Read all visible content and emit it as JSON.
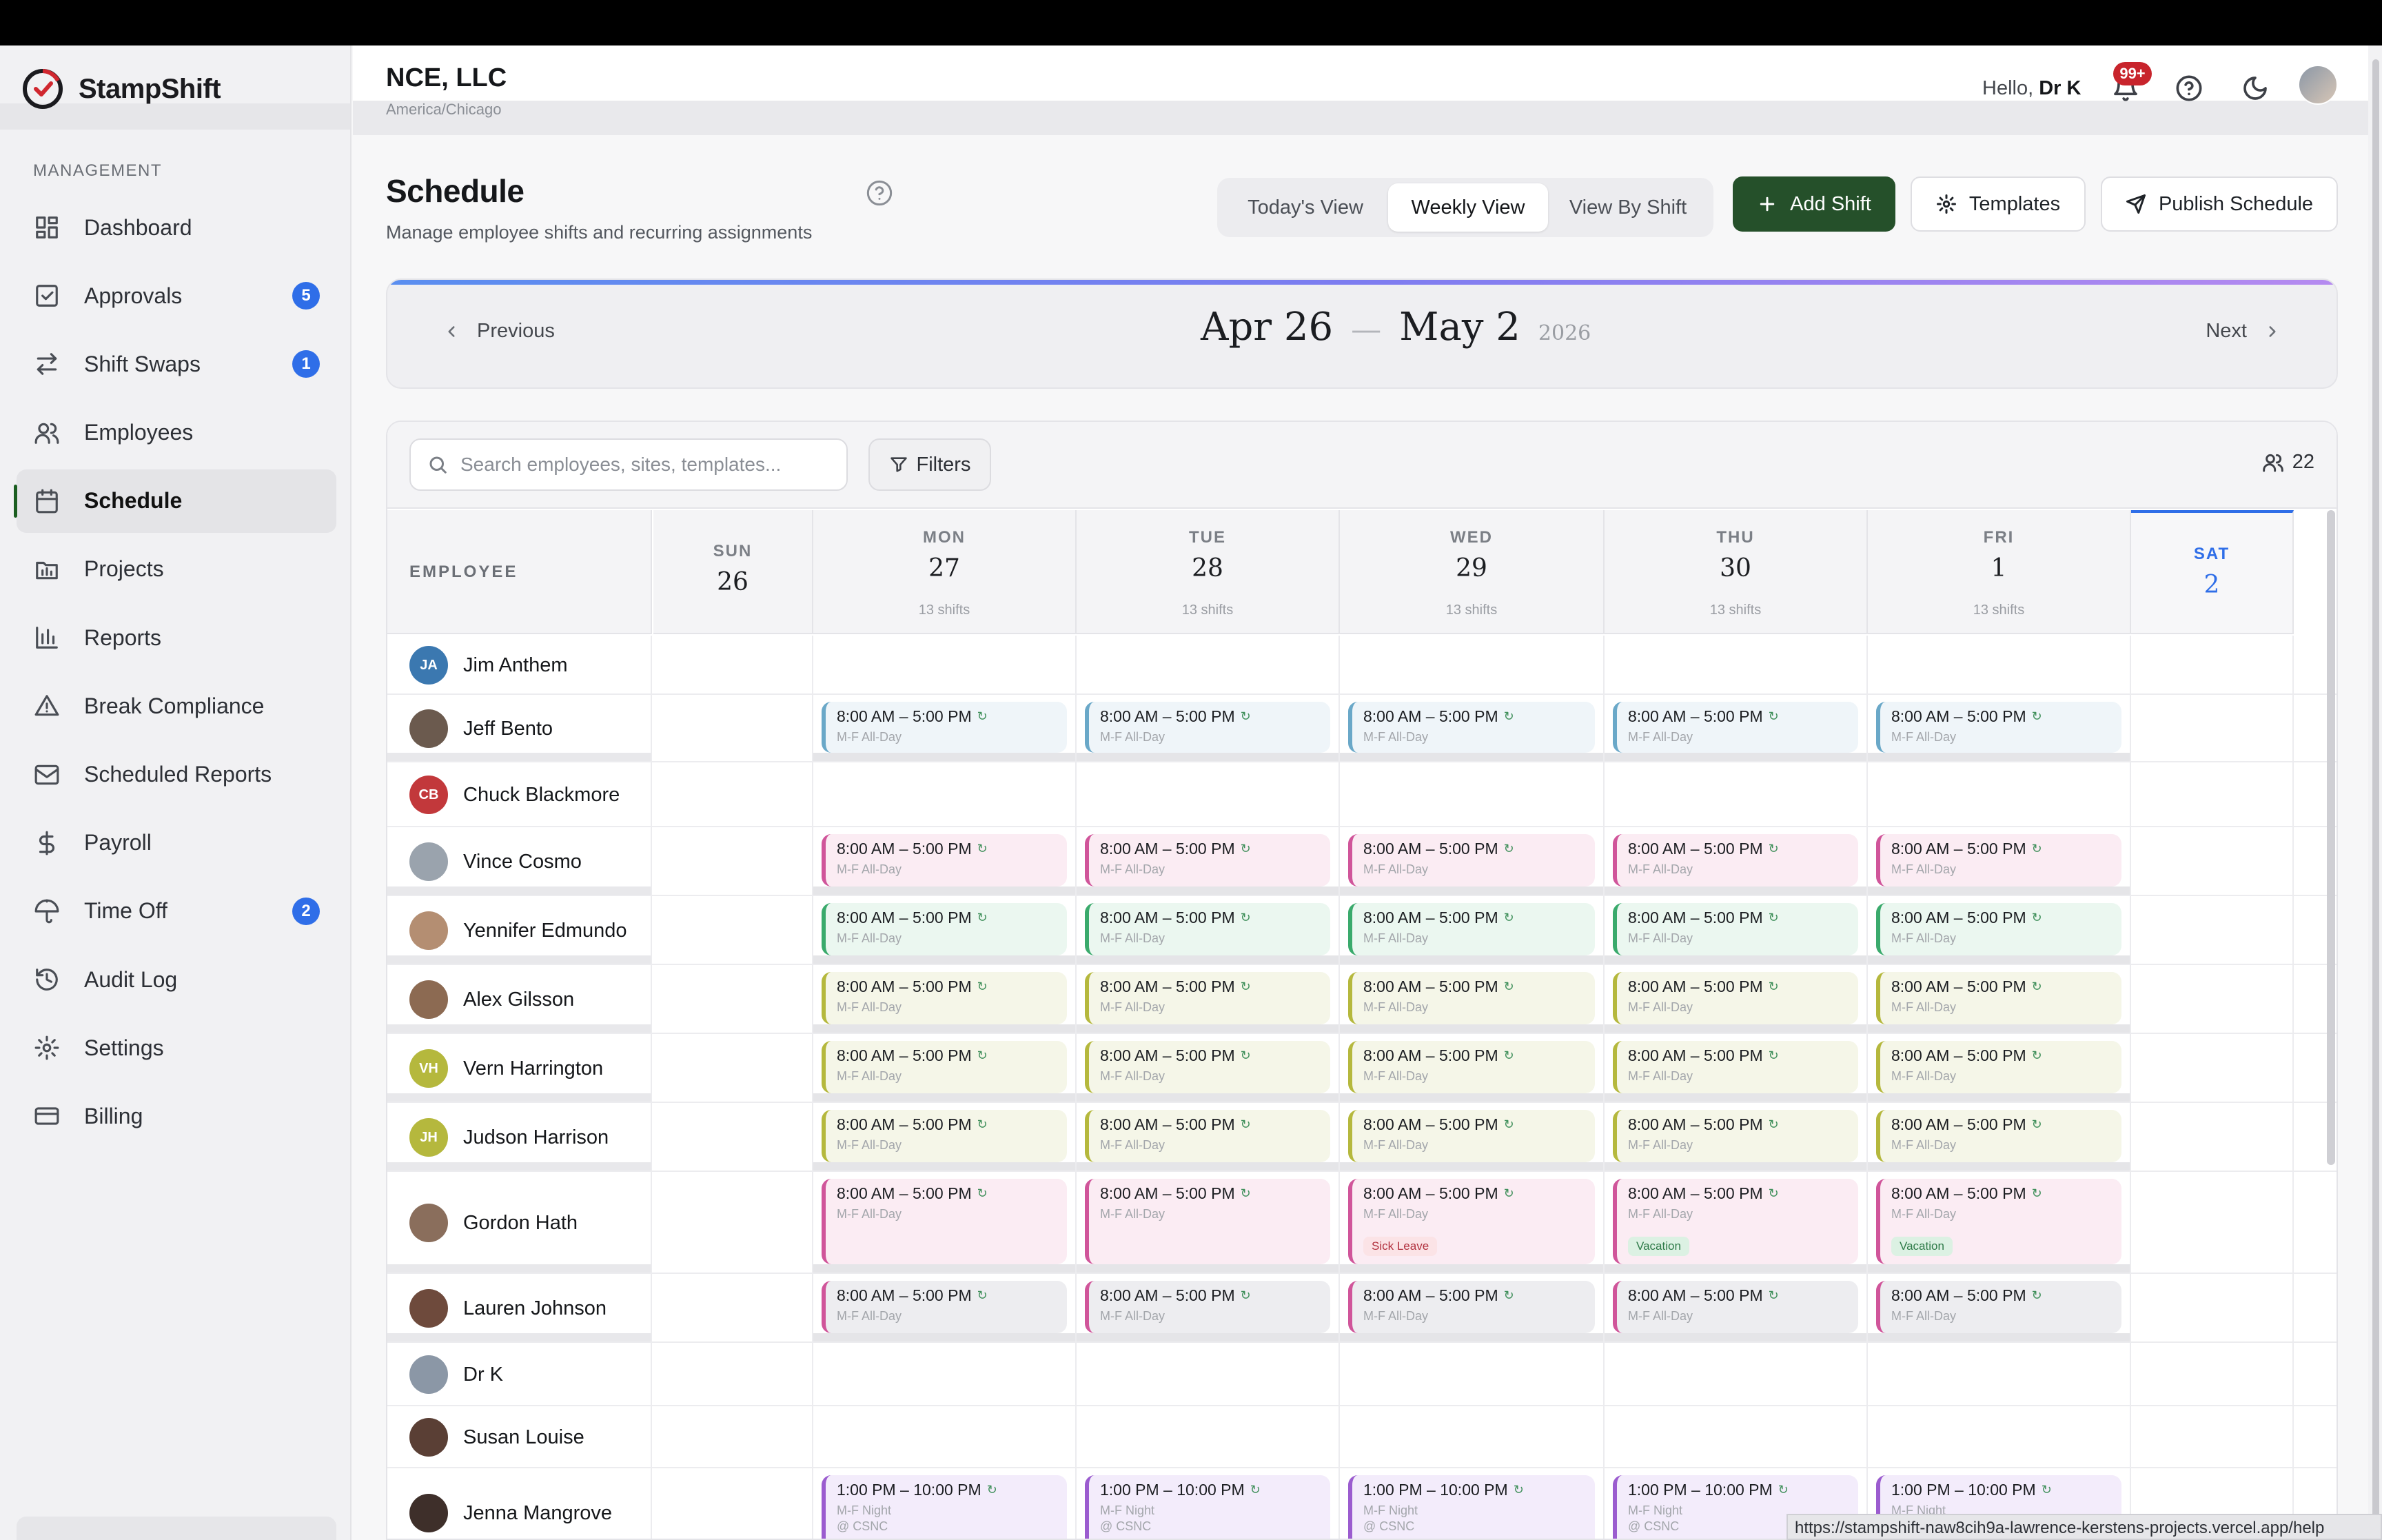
{
  "brand": {
    "name": "StampShift"
  },
  "sidebar": {
    "section": "MANAGEMENT",
    "items": [
      {
        "label": "Dashboard",
        "icon": "dashboard-icon",
        "badge": ""
      },
      {
        "label": "Approvals",
        "icon": "approvals-icon",
        "badge": "5"
      },
      {
        "label": "Shift Swaps",
        "icon": "swap-icon",
        "badge": "1"
      },
      {
        "label": "Employees",
        "icon": "users-icon",
        "badge": ""
      },
      {
        "label": "Schedule",
        "icon": "calendar-icon",
        "badge": "",
        "active": true
      },
      {
        "label": "Projects",
        "icon": "projects-icon",
        "badge": ""
      },
      {
        "label": "Reports",
        "icon": "reports-icon",
        "badge": ""
      },
      {
        "label": "Break Compliance",
        "icon": "warning-icon",
        "badge": ""
      },
      {
        "label": "Scheduled Reports",
        "icon": "mail-icon",
        "badge": ""
      },
      {
        "label": "Payroll",
        "icon": "dollar-icon",
        "badge": ""
      },
      {
        "label": "Time Off",
        "icon": "umbrella-icon",
        "badge": "2"
      },
      {
        "label": "Audit Log",
        "icon": "history-icon",
        "badge": ""
      },
      {
        "label": "Settings",
        "icon": "gear-icon",
        "badge": ""
      },
      {
        "label": "Billing",
        "icon": "card-icon",
        "badge": ""
      }
    ]
  },
  "header": {
    "org": "NCE, LLC",
    "timezone": "America/Chicago",
    "hello_prefix": "Hello,",
    "user": "Dr K",
    "notif_badge": "99+"
  },
  "page": {
    "title": "Schedule",
    "subtitle": "Manage employee shifts and recurring assignments",
    "views": [
      "Today's View",
      "Weekly View",
      "View By Shift"
    ],
    "active_view": "Weekly View",
    "add_shift": "Add Shift",
    "templates": "Templates",
    "publish": "Publish Schedule"
  },
  "week": {
    "prev": "Previous",
    "next": "Next",
    "start": "Apr 26",
    "dash": "—",
    "end": "May 2",
    "year": "2026"
  },
  "toolbar": {
    "search_placeholder": "Search employees, sites, templates...",
    "filters": "Filters",
    "employee_count": "22"
  },
  "grid": {
    "employee_header": "EMPLOYEE",
    "days": [
      {
        "dow": "SUN",
        "dom": "26",
        "count": ""
      },
      {
        "dow": "MON",
        "dom": "27",
        "count": "13 shifts"
      },
      {
        "dow": "TUE",
        "dom": "28",
        "count": "13 shifts"
      },
      {
        "dow": "WED",
        "dom": "29",
        "count": "13 shifts"
      },
      {
        "dow": "THU",
        "dom": "30",
        "count": "13 shifts"
      },
      {
        "dow": "FRI",
        "dom": "1",
        "count": "13 shifts"
      },
      {
        "dow": "SAT",
        "dom": "2",
        "count": "",
        "today": true
      }
    ],
    "employees": [
      {
        "name": "Jim Anthem",
        "initials": "JA",
        "avatar_color": "#3b78b0",
        "color": "",
        "shifts": []
      },
      {
        "name": "Jeff Bento",
        "initials": "",
        "avatar_color": "#6b5a4e",
        "color": "blue",
        "shifts": [
          "day",
          "day",
          "day",
          "day",
          "day"
        ]
      },
      {
        "name": "Chuck Blackmore",
        "initials": "CB",
        "avatar_color": "#c2383b",
        "color": "",
        "shifts": []
      },
      {
        "name": "Vince Cosmo",
        "initials": "",
        "avatar_color": "#9aa3ad",
        "color": "pink",
        "shifts": [
          "day",
          "day",
          "day",
          "day",
          "day"
        ]
      },
      {
        "name": "Yennifer Edmundo",
        "initials": "",
        "avatar_color": "#b48e72",
        "color": "green",
        "shifts": [
          "day",
          "day",
          "day",
          "day",
          "day"
        ]
      },
      {
        "name": "Alex Gilsson",
        "initials": "",
        "avatar_color": "#8c6a52",
        "color": "olive",
        "shifts": [
          "day",
          "day",
          "day",
          "day",
          "day"
        ]
      },
      {
        "name": "Vern Harrington",
        "initials": "VH",
        "avatar_color": "#b5b83d",
        "color": "olive",
        "shifts": [
          "day",
          "day",
          "day",
          "day",
          "day"
        ]
      },
      {
        "name": "Judson Harrison",
        "initials": "JH",
        "avatar_color": "#b5b83d",
        "color": "olive",
        "shifts": [
          "day",
          "day",
          "day",
          "day",
          "day"
        ]
      },
      {
        "name": "Gordon Hath",
        "initials": "",
        "avatar_color": "#8a6e5c",
        "color": "pink",
        "shifts": [
          "day",
          "day",
          "day",
          "day",
          "day"
        ],
        "tags": [
          "",
          "",
          "Sick Leave",
          "Vacation",
          "Vacation"
        ]
      },
      {
        "name": "Lauren Johnson",
        "initials": "",
        "avatar_color": "#6e4a3c",
        "color": "gray",
        "shifts": [
          "day",
          "day",
          "day",
          "day",
          "day"
        ]
      },
      {
        "name": "Dr K",
        "initials": "",
        "avatar_color": "#8b97a6",
        "color": "",
        "shifts": []
      },
      {
        "name": "Susan Louise",
        "initials": "",
        "avatar_color": "#5a3f35",
        "color": "",
        "shifts": []
      },
      {
        "name": "Jenna Mangrove",
        "initials": "",
        "avatar_color": "#3e2f2a",
        "color": "purple",
        "shifts": [
          "night",
          "night",
          "night",
          "night",
          "night"
        ]
      }
    ],
    "shift_day": {
      "time": "8:00 AM – 5:00 PM",
      "template": "M-F All-Day"
    },
    "shift_night": {
      "time": "1:00 PM – 10:00 PM",
      "template": "M-F Night",
      "site": "@ CSNC"
    },
    "recurring_glyph": "↻"
  },
  "status_url": "https://stampshift-naw8cih9a-lawrence-kerstens-projects.vercel.app/help"
}
